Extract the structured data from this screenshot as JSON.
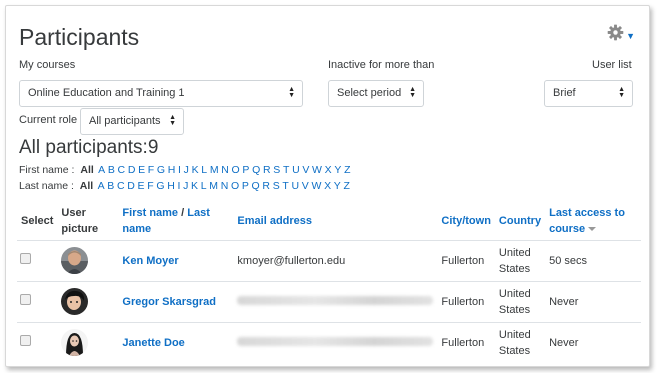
{
  "page": {
    "title": "Participants",
    "settings_icon": "gear-icon"
  },
  "filters": {
    "my_courses_label": "My courses",
    "course_value": "Online Education and Training 1",
    "inactive_label": "Inactive for more than",
    "inactive_value": "Select period",
    "user_list_label": "User list",
    "user_list_value": "Brief",
    "current_role_label": "Current role",
    "current_role_value": "All participants"
  },
  "summary": {
    "heading": "All participants:9"
  },
  "alphabet": {
    "first_label": "First name :",
    "last_label": "Last name :",
    "all": "All",
    "letters": [
      "A",
      "B",
      "C",
      "D",
      "E",
      "F",
      "G",
      "H",
      "I",
      "J",
      "K",
      "L",
      "M",
      "N",
      "O",
      "P",
      "Q",
      "R",
      "S",
      "T",
      "U",
      "V",
      "W",
      "X",
      "Y",
      "Z"
    ]
  },
  "table": {
    "headers": {
      "select": "Select",
      "picture": "User picture",
      "first": "First name",
      "slash": " / ",
      "last": "Last name",
      "email": "Email address",
      "city": "City/town",
      "country": "Country",
      "access": "Last access to course"
    },
    "rows": [
      {
        "name": "Ken Moyer",
        "email": "kmoyer@fullerton.edu",
        "city": "Fullerton",
        "country": "United States",
        "access": "50 secs",
        "email_blurred": false
      },
      {
        "name": "Gregor Skarsgrad",
        "email": "",
        "city": "Fullerton",
        "country": "United States",
        "access": "Never",
        "email_blurred": true
      },
      {
        "name": "Janette Doe",
        "email": "",
        "city": "Fullerton",
        "country": "United States",
        "access": "Never",
        "email_blurred": true
      }
    ]
  },
  "colors": {
    "link": "#0f6fc5",
    "text": "#373a3c",
    "border": "#dee2e6"
  }
}
